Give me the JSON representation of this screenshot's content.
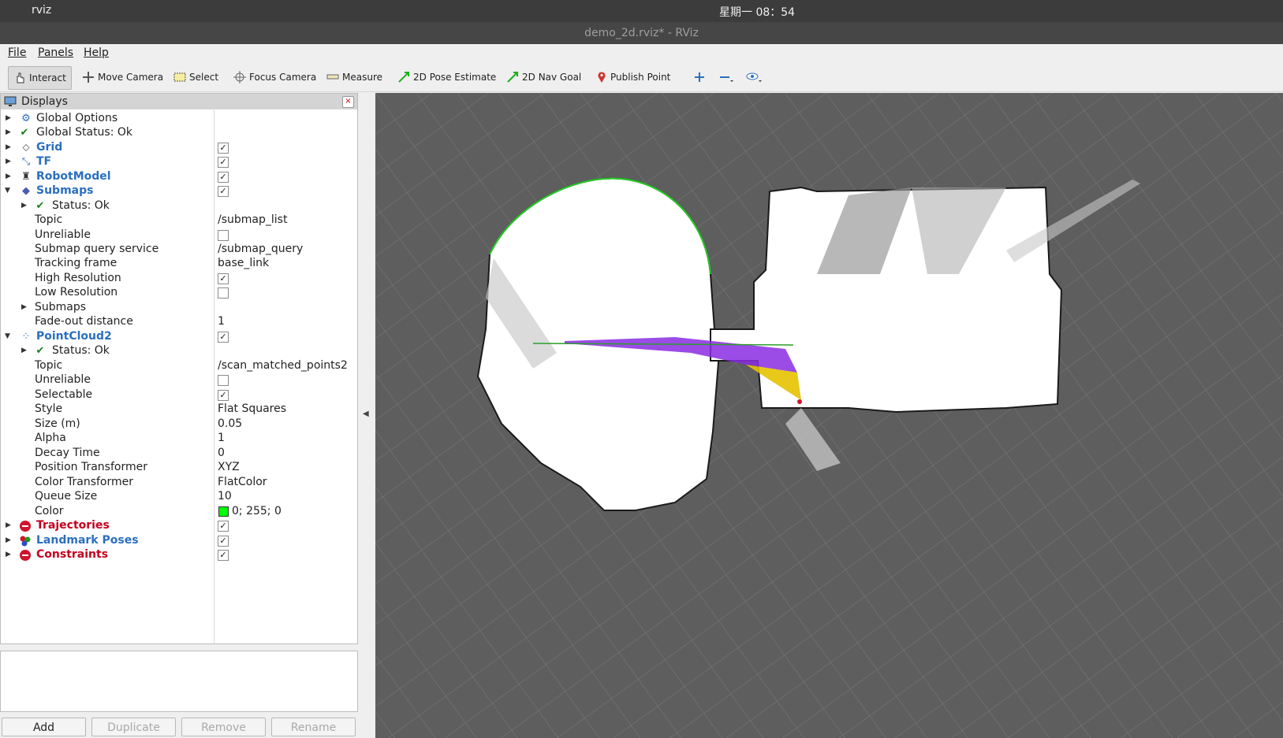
{
  "top_bar": {
    "app_name": "rviz",
    "clock": "星期一 08：54"
  },
  "window_title": "demo_2d.rviz* - RViz",
  "menu": [
    "File",
    "Panels",
    "Help"
  ],
  "toolbar": {
    "interact": "Interact",
    "move_camera": "Move Camera",
    "select": "Select",
    "focus_camera": "Focus Camera",
    "measure": "Measure",
    "pose_estimate": "2D Pose Estimate",
    "nav_goal": "2D Nav Goal",
    "publish_point": "Publish Point"
  },
  "displays_panel": {
    "title": "Displays",
    "rows": [
      {
        "label": "Global Options"
      },
      {
        "label": "Global Status: Ok"
      },
      {
        "label": "Grid",
        "checked": true
      },
      {
        "label": "TF",
        "checked": true
      },
      {
        "label": "RobotModel",
        "checked": true
      },
      {
        "label": "Submaps",
        "checked": true
      },
      {
        "label": "Status: Ok"
      },
      {
        "label": "Topic",
        "value": "/submap_list"
      },
      {
        "label": "Unreliable",
        "checked": false
      },
      {
        "label": "Submap query service",
        "value": "/submap_query"
      },
      {
        "label": "Tracking frame",
        "value": "base_link"
      },
      {
        "label": "High Resolution",
        "checked": true
      },
      {
        "label": "Low Resolution",
        "checked": false
      },
      {
        "label": "Submaps"
      },
      {
        "label": "Fade-out distance",
        "value": "1"
      },
      {
        "label": "PointCloud2",
        "checked": true
      },
      {
        "label": "Status: Ok"
      },
      {
        "label": "Topic",
        "value": "/scan_matched_points2"
      },
      {
        "label": "Unreliable",
        "checked": false
      },
      {
        "label": "Selectable",
        "checked": true
      },
      {
        "label": "Style",
        "value": "Flat Squares"
      },
      {
        "label": "Size (m)",
        "value": "0.05"
      },
      {
        "label": "Alpha",
        "value": "1"
      },
      {
        "label": "Decay Time",
        "value": "0"
      },
      {
        "label": "Position Transformer",
        "value": "XYZ"
      },
      {
        "label": "Color Transformer",
        "value": "FlatColor"
      },
      {
        "label": "Queue Size",
        "value": "10"
      },
      {
        "label": "Color",
        "value": "0; 255; 0",
        "swatch": "#00ff00"
      },
      {
        "label": "Trajectories",
        "checked": true
      },
      {
        "label": "Landmark Poses",
        "checked": true
      },
      {
        "label": "Constraints",
        "checked": true
      }
    ]
  },
  "buttons": {
    "add": "Add",
    "duplicate": "Duplicate",
    "remove": "Remove",
    "rename": "Rename"
  },
  "colors": {
    "viewport_bg": "#5e5e5e",
    "grid": "#7a7a7a",
    "map_free": "#ffffff",
    "scan": "#00ff00",
    "trajectory_a": "#8a2be2",
    "trajectory_b": "#e6c200",
    "error_red": "#c2001e",
    "link_blue": "#2a6fc0"
  }
}
